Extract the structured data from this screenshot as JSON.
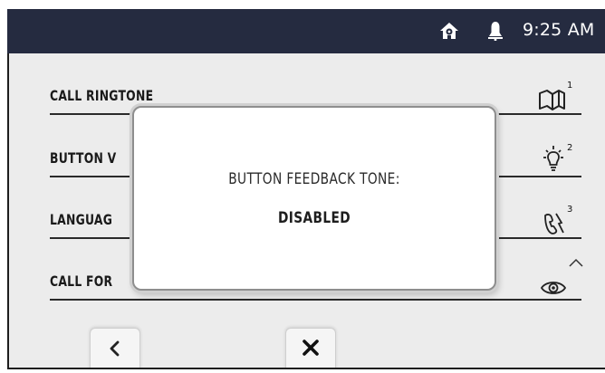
{
  "status_bar": {
    "time": "9:25 AM",
    "icons": [
      "home-icon",
      "bell-icon"
    ]
  },
  "settings": {
    "rows": [
      {
        "label": "CALL RINGTONE",
        "icon": "book-icon",
        "badge": "1"
      },
      {
        "label": "BUTTON V",
        "icon": "light-bulb-icon",
        "badge": "2"
      },
      {
        "label": "LANGUAG",
        "icon": "phone-hand-icon",
        "badge": "3"
      },
      {
        "label": "CALL FOR",
        "icon": "eye-icon",
        "badge": "scroll-up-indicator"
      }
    ]
  },
  "modal": {
    "line1": "BUTTON FEEDBACK TONE:",
    "line2": "DISABLED"
  },
  "nav": {
    "back_icon": "chevron-left-icon",
    "close_icon": "close-icon"
  },
  "colors": {
    "status_bar_bg": "#252b40",
    "screen_bg": "#ececec",
    "modal_bg": "#ffffff"
  }
}
